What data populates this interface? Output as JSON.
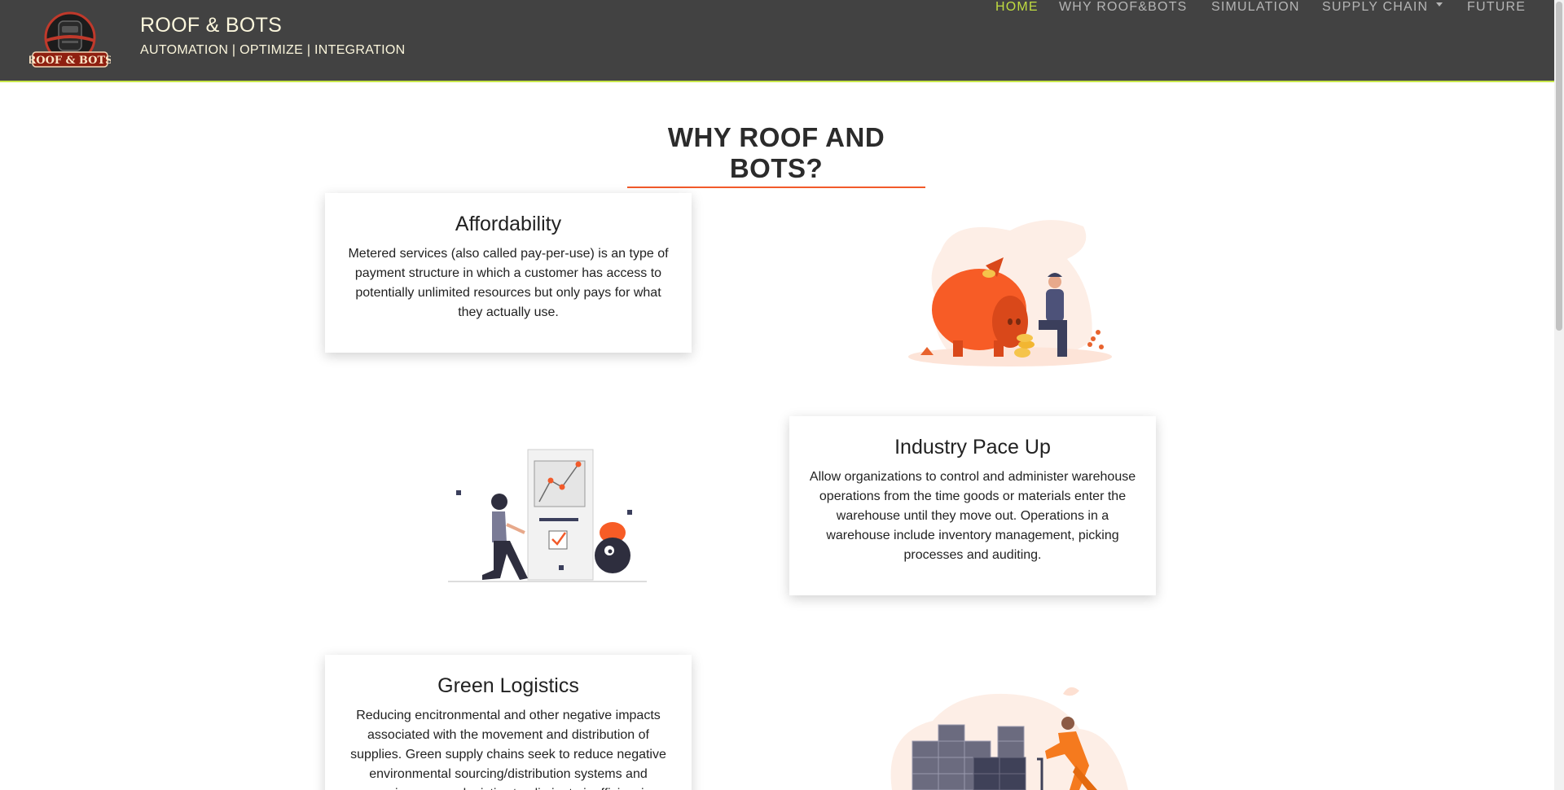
{
  "brand": {
    "logo_text": "ROOF & BOTS",
    "title": "ROOF & BOTS",
    "tagline": "AUTOMATION | OPTIMIZE | INTEGRATION"
  },
  "nav": {
    "items": [
      {
        "label": "HOME",
        "active": true
      },
      {
        "label": "WHY ROOF&BOTS",
        "active": false
      },
      {
        "label": "SIMULATION",
        "active": false
      },
      {
        "label": "SUPPLY CHAIN",
        "active": false,
        "dropdown": true
      },
      {
        "label": "FUTURE",
        "active": false
      }
    ]
  },
  "section": {
    "title": "WHY ROOF AND BOTS?"
  },
  "cards": [
    {
      "title": "Affordability",
      "body": "Metered services (also called pay-per-use) is an type of payment structure in which a customer has access to potentially unlimited resources but only pays for what they actually use.",
      "illustration": "piggy-bank-illustration"
    },
    {
      "title": "Industry Pace Up",
      "body": "Allow organizations to control and administer warehouse operations from the time goods or materials enter the warehouse until they move out. Operations in a warehouse include inventory management, picking processes and auditing.",
      "illustration": "analytics-board-illustration"
    },
    {
      "title": "Green Logistics",
      "body": "Reducing encitronmental and other negative impacts associated with the movement and distribution of supplies. Green supply chains seek to reduce negative environmental sourcing/distribution systems and managing reverse logistics to eliminate inefficiencies.",
      "illustration": "warehouse-boxes-illustration"
    }
  ],
  "colors": {
    "navbar": "#424242",
    "accent_green": "#c0dc40",
    "accent_orange": "#f25a2a",
    "brand_text": "#fbf6dc"
  }
}
